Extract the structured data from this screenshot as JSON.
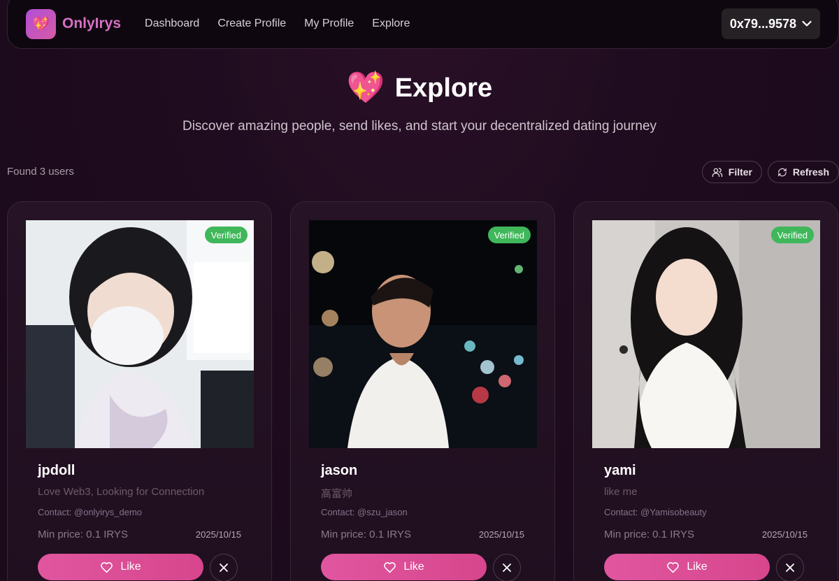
{
  "nav": {
    "logo_icon": "sparkling-heart-icon",
    "brand": "OnlyIrys",
    "links": [
      "Dashboard",
      "Create Profile",
      "My Profile",
      "Explore"
    ],
    "wallet": "0x79...9578"
  },
  "hero": {
    "emoji": "💖",
    "title": "Explore",
    "subtitle": "Discover amazing people, send likes, and start your decentralized dating journey"
  },
  "toolbar": {
    "found": "Found 3 users",
    "filter": "Filter",
    "refresh": "Refresh"
  },
  "cards": [
    {
      "badge": "Verified",
      "name": "jpdoll",
      "bio": "Love Web3, Looking for Connection",
      "contact": "Contact: @onlyirys_demo",
      "price": "Min price: 0.1 IRYS",
      "date": "2025/10/15",
      "like": "Like"
    },
    {
      "badge": "Verified",
      "name": "jason",
      "bio": "高富帅",
      "contact": "Contact: @szu_jason",
      "price": "Min price: 0.1 IRYS",
      "date": "2025/10/15",
      "like": "Like"
    },
    {
      "badge": "Verified",
      "name": "yami",
      "bio": "like me",
      "contact": "Contact: @Yamisobeauty",
      "price": "Min price: 0.1 IRYS",
      "date": "2025/10/15",
      "like": "Like"
    }
  ],
  "colors": {
    "accent": "#d7468d",
    "verified": "#3fb75a",
    "brand": "#d670c4"
  }
}
